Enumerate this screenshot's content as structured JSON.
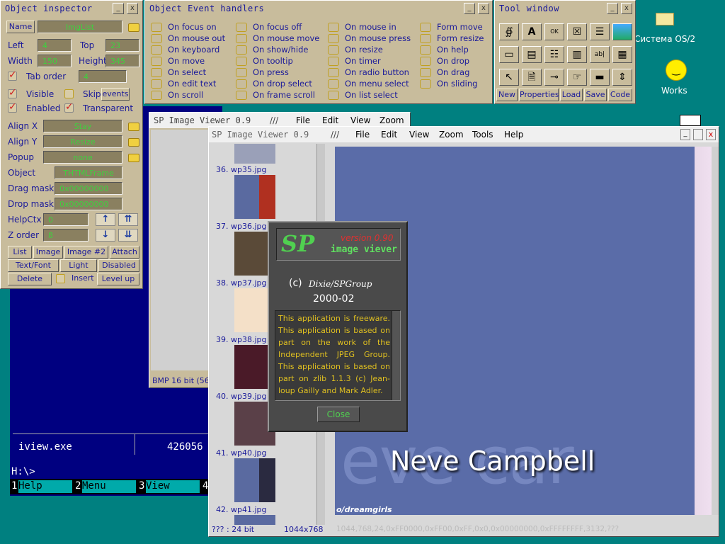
{
  "desktop": {
    "icons": [
      {
        "label": "Система OS/2",
        "icon": "folder-icon"
      },
      {
        "label": "Works",
        "icon": "smiley-icon"
      }
    ]
  },
  "inspector": {
    "title": "Object inspector",
    "name_label": "Name",
    "name_value": "ImgList",
    "left_label": "Left",
    "left_value": "4",
    "top_label": "Top",
    "top_value": "23",
    "width_label": "Width",
    "width_value": "150",
    "height_label": "Height",
    "height_value": "345",
    "taborder_label": "Tab order",
    "taborder_value": "4",
    "visible": "Visible",
    "skip": "Skip",
    "events": "events",
    "enabled": "Enabled",
    "transparent": "Transparent",
    "alignx_label": "Align X",
    "alignx_value": "Stay",
    "aligny_label": "Align Y",
    "aligny_value": "Resize",
    "popup_label": "Popup",
    "popup_value": "none",
    "object_label": "Object",
    "object_value": "THTMLFrame",
    "dragmask_label": "Drag mask",
    "dragmask_value": "0x00000000",
    "dropmask_label": "Drop mask",
    "dropmask_value": "0x00000000",
    "helpctx_label": "HelpCtx",
    "helpctx_value": "0",
    "zorder_label": "Z order",
    "zorder_value": "8",
    "tabs": [
      "List",
      "Image",
      "Image #2",
      "Attach"
    ],
    "row2": [
      "Text/Font",
      "Light",
      "Disabled"
    ],
    "delete": "Delete",
    "insert": "Insert",
    "levelup": "Level up"
  },
  "events": {
    "title": "Object Event handlers",
    "items": [
      "On focus on",
      "On mouse out",
      "On keyboard",
      "On move",
      "On select",
      "On edit text",
      "On scroll",
      "On focus off",
      "On mouse move",
      "On show/hide",
      "On tooltip",
      "On press",
      "On drop select",
      "On frame scroll",
      "On mouse in",
      "On mouse press",
      "On resize",
      "On timer",
      "On radio button",
      "On menu select",
      "On list select",
      "Form move",
      "Form resize",
      "On help",
      "On drop",
      "On drag",
      "On sliding"
    ]
  },
  "toolwin": {
    "title": "Tool window",
    "buttons": [
      "New",
      "Properties",
      "Load",
      "Save",
      "Code"
    ]
  },
  "viewer_back": {
    "title": "SP Image Viewer 0.9",
    "sep": "///",
    "menu": [
      "File",
      "Edit",
      "View",
      "Zoom",
      "Tools",
      "Help"
    ],
    "status": "BMP 16 bit (56"
  },
  "viewer": {
    "title": "SP Image Viewer 0.9",
    "sep": "///",
    "menu": [
      "File",
      "Edit",
      "View",
      "Zoom",
      "Tools",
      "Help"
    ],
    "thumbs": [
      "36. wp35.jpg",
      "37. wp36.jpg",
      "38. wp37.jpg",
      "39. wp38.jpg",
      "40. wp39.jpg",
      "41. wp40.jpg",
      "42. wp41.jpg"
    ],
    "image_text": "Neve Campbell",
    "image_bg_text": "eve car",
    "image_url": "o/dreamgirls",
    "status": [
      "??? : 24 bit",
      "1044x768",
      "1044,768,24,0xFF0000,0xFF00,0xFF,0x0,0x00000000,0xFFFFFFFF,3132,???"
    ]
  },
  "about": {
    "logo": "SP",
    "version": "version 0.90",
    "app": "image viever",
    "copyright": "(c)",
    "author": "Dixie/SPGroup",
    "date": "2000-02",
    "text": "This application is freeware. This application is based on part on the work of the Independent JPEG Group. This application is based on part on zlib 1.1.3 (c) Jean-loup Gailly and Mark Adler.",
    "close": "Close"
  },
  "console": {
    "file": "iview.exe",
    "size": "426056",
    "prompt": "H:\\>",
    "keys": [
      {
        "n": "1",
        "l": "Help"
      },
      {
        "n": "2",
        "l": "Menu"
      },
      {
        "n": "3",
        "l": "View"
      },
      {
        "n": "4",
        "l": ""
      }
    ]
  },
  "colors": {
    "teal": "#008080",
    "tan": "#c8bc9c",
    "navy": "#000080",
    "field_green": "#3fd03f"
  }
}
